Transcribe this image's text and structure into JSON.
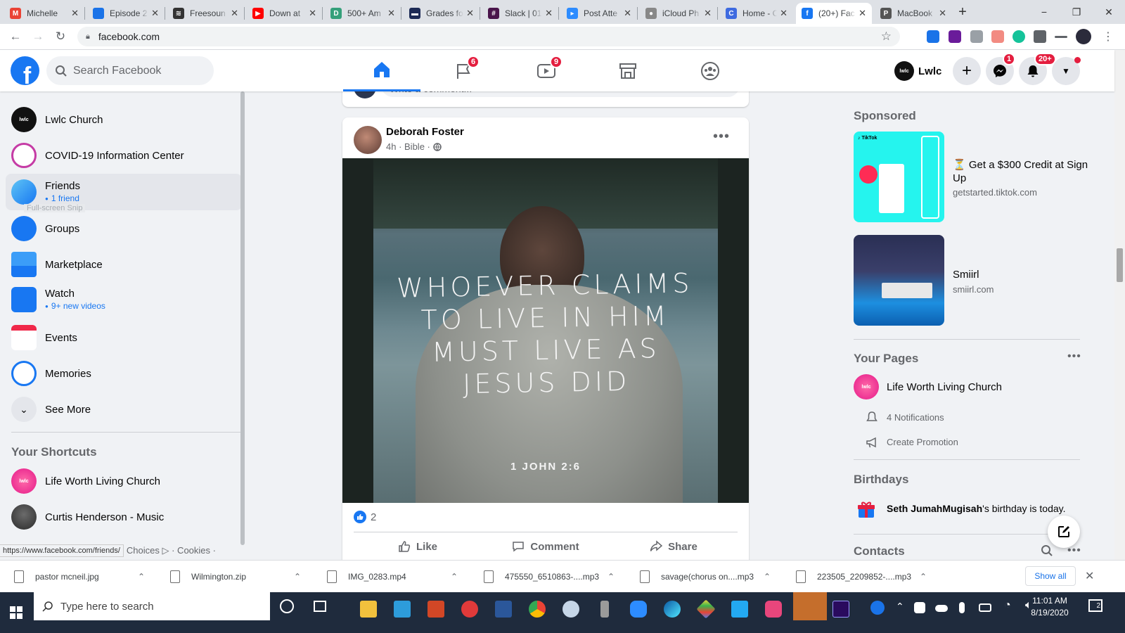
{
  "browser": {
    "tabs": [
      {
        "title": "Michelle",
        "fav": "gmail",
        "color": "#ea4335",
        "glyph": "M"
      },
      {
        "title": "Episode 2",
        "fav": "cloud",
        "color": "#1a73e8",
        "glyph": ""
      },
      {
        "title": "Freesoun",
        "fav": "waveform",
        "color": "#333333",
        "glyph": "≋"
      },
      {
        "title": "Down at",
        "fav": "youtube",
        "color": "#ff0000",
        "glyph": "▶"
      },
      {
        "title": "500+ Am",
        "fav": "d",
        "color": "#35a07a",
        "glyph": "D"
      },
      {
        "title": "Grades fo",
        "fav": "flag",
        "color": "#1c2a55",
        "glyph": "▬"
      },
      {
        "title": "Slack | 01",
        "fav": "slack",
        "color": "#4a154b",
        "glyph": "#"
      },
      {
        "title": "Post Atte",
        "fav": "zoom",
        "color": "#2d8cff",
        "glyph": "▸"
      },
      {
        "title": "iCloud Ph",
        "fav": "apple",
        "color": "#888888",
        "glyph": "●"
      },
      {
        "title": "Home - C",
        "fav": "c",
        "color": "#3f6be0",
        "glyph": "C"
      },
      {
        "title": "(20+) Fac",
        "fav": "facebook",
        "color": "#1877f2",
        "glyph": "f",
        "active": true
      },
      {
        "title": "MacBook",
        "fav": "p",
        "color": "#555555",
        "glyph": "P"
      }
    ],
    "new_tab": "+",
    "window_controls": [
      "−",
      "❐",
      "✕"
    ],
    "url": "facebook.com",
    "status_url": "https://www.facebook.com/friends/"
  },
  "fb": {
    "search_placeholder": "Search Facebook",
    "nav_badges": {
      "pages": "6",
      "watch": "9"
    },
    "profile_name": "Lwlc",
    "messenger_badge": "1",
    "notif_badge": "20+"
  },
  "left": {
    "items": [
      {
        "label": "Lwlc Church",
        "icon": "avatar-lwlc",
        "sub": ""
      },
      {
        "label": "COVID-19 Information Center",
        "icon": "covid-heart-icon",
        "sub": ""
      },
      {
        "label": "Friends",
        "icon": "friends-icon",
        "sub": "1 friend"
      },
      {
        "label": "Groups",
        "icon": "groups-icon",
        "sub": ""
      },
      {
        "label": "Marketplace",
        "icon": "marketplace-icon",
        "sub": ""
      },
      {
        "label": "Watch",
        "icon": "watch-icon",
        "sub": "9+ new videos"
      },
      {
        "label": "Events",
        "icon": "events-icon",
        "sub": ""
      },
      {
        "label": "Memories",
        "icon": "memories-icon",
        "sub": ""
      },
      {
        "label": "See More",
        "icon": "chevron-down-icon",
        "sub": ""
      }
    ],
    "tooltip": "Full-screen Snip",
    "shortcuts_title": "Your Shortcuts",
    "shortcuts": [
      {
        "label": "Life Worth Living Church"
      },
      {
        "label": "Curtis Henderson - Music"
      }
    ],
    "footer": "Choices ▷ · Cookies ·"
  },
  "feed": {
    "comment_placeholder": "Write a comment...",
    "post": {
      "author": "Deborah Foster",
      "meta": "4h · Bible ·",
      "image_text_lines": [
        "WHOEVER CLAIMS",
        "TO LIVE IN HIM",
        "MUST LIVE AS",
        "JESUS DID"
      ],
      "image_ref": "1 JOHN 2:6",
      "reactions": "2",
      "actions": [
        "Like",
        "Comment",
        "Share"
      ]
    }
  },
  "right": {
    "sponsored_title": "Sponsored",
    "ads": [
      {
        "title": "⏳ Get a $300 Credit at Sign Up",
        "domain": "getstarted.tiktok.com"
      },
      {
        "title": "Smiirl",
        "domain": "smiirl.com"
      }
    ],
    "pages_title": "Your Pages",
    "page_name": "Life Worth Living Church",
    "notifications": "4 Notifications",
    "create_promotion": "Create Promotion",
    "birthdays_title": "Birthdays",
    "birthday_name": "Seth JumahMugisah",
    "birthday_suffix": "'s birthday is today.",
    "contacts_title": "Contacts"
  },
  "downloads": {
    "files": [
      "pastor mcneil.jpg",
      "Wilmington.zip",
      "IMG_0283.mp4",
      "475550_6510863-....mp3",
      "savage(chorus on....mp3",
      "223505_2209852-....mp3"
    ],
    "show_all": "Show all"
  },
  "taskbar": {
    "search_placeholder": "Type here to search",
    "time": "11:01 AM",
    "date": "8/19/2020",
    "notif_count": "2"
  }
}
